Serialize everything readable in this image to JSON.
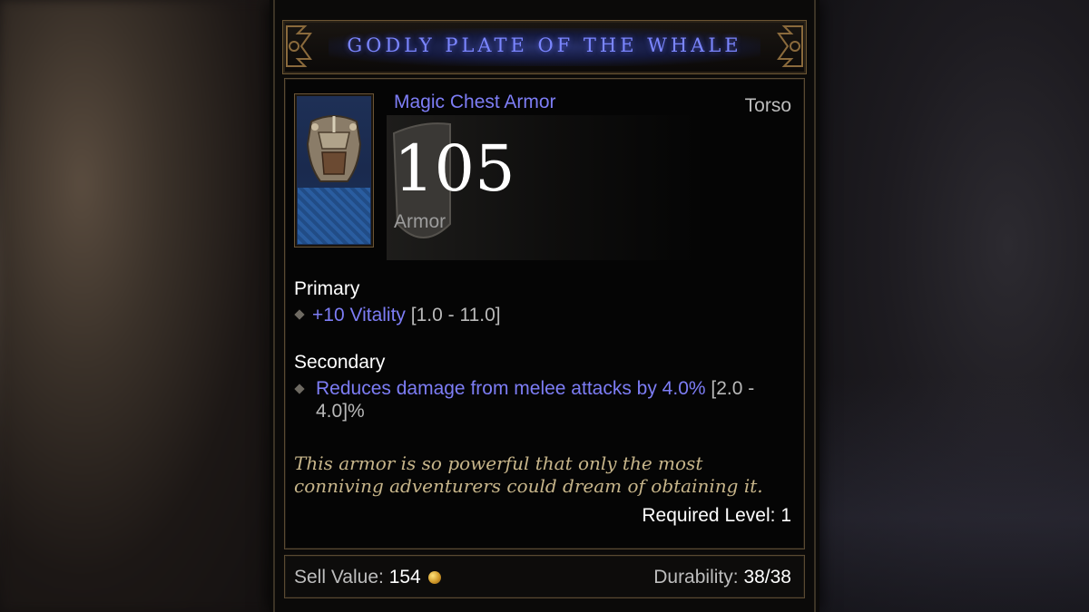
{
  "item": {
    "name": "GODLY PLATE OF THE WHALE",
    "type": "Magic Chest Armor",
    "slot": "Torso",
    "armor_value": "105",
    "armor_label": "Armor",
    "icon": "chest-armor-icon"
  },
  "primary": {
    "title": "Primary",
    "affixes": [
      {
        "text": "+10 Vitality",
        "range": "[1.0 - 11.0]"
      }
    ]
  },
  "secondary": {
    "title": "Secondary",
    "affixes": [
      {
        "text": "Reduces damage from melee attacks by 4.0%",
        "range": "[2.0 - 4.0]%"
      }
    ]
  },
  "flavor_text": "This armor is so powerful that only the most conniving adventurers could dream of obtaining it.",
  "required_level": "Required Level: 1",
  "footer": {
    "sell_label": "Sell Value:",
    "sell_value": "154",
    "durability_label": "Durability:",
    "durability_value": "38/38"
  },
  "colors": {
    "magic_blue": "#7d7df5",
    "flavor_gold": "#c7b58a",
    "border_bronze": "#5a4a32"
  }
}
